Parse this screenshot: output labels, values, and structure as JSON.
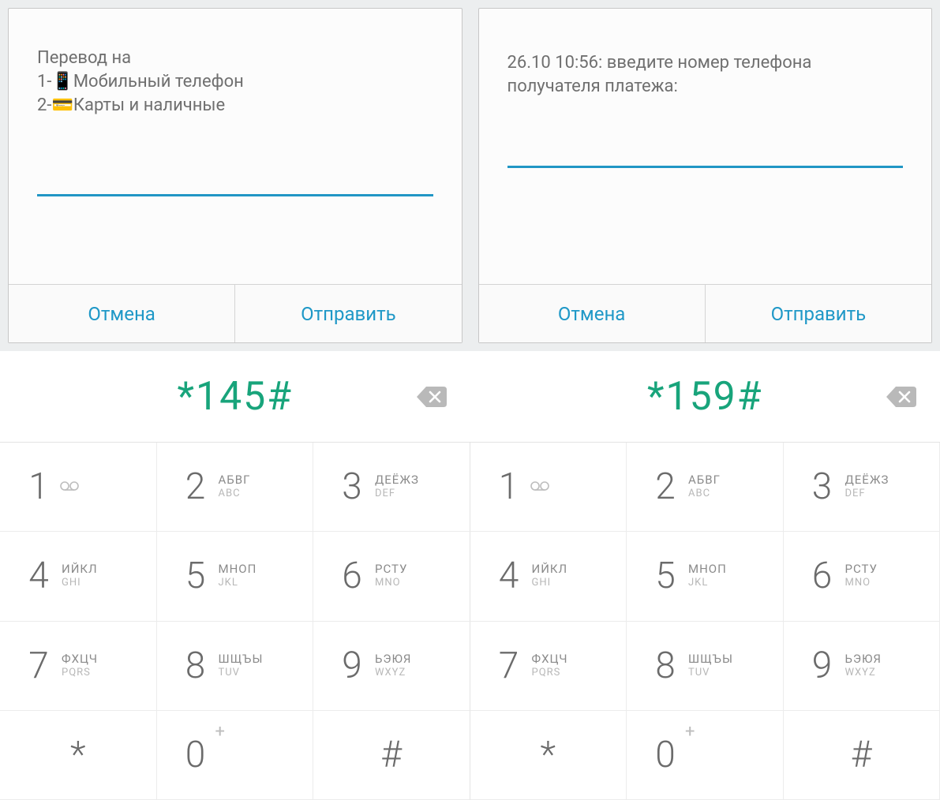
{
  "dialogs": {
    "left": {
      "line1": "Перевод на",
      "line2": "1-📱Мобильный телефон",
      "line3": "2-💳Карты и наличные",
      "cancel": "Отмена",
      "send": "Отправить"
    },
    "right": {
      "line1": "26.10 10:56: введите номер телефона",
      "line2": "получателя платежа:",
      "cancel": "Отмена",
      "send": "Отправить"
    }
  },
  "dial": {
    "left": "*145#",
    "right": "*159#"
  },
  "keypad": [
    {
      "d": "1",
      "l1": "",
      "l2": "",
      "vm": true
    },
    {
      "d": "2",
      "l1": "АБВГ",
      "l2": "ABC"
    },
    {
      "d": "3",
      "l1": "ДЕЁЖЗ",
      "l2": "DEF"
    },
    {
      "d": "4",
      "l1": "ИЙКЛ",
      "l2": "GHI"
    },
    {
      "d": "5",
      "l1": "МНОП",
      "l2": "JKL"
    },
    {
      "d": "6",
      "l1": "РСТУ",
      "l2": "MNO"
    },
    {
      "d": "7",
      "l1": "ФХЦЧ",
      "l2": "PQRS"
    },
    {
      "d": "8",
      "l1": "ШЩЪЫ",
      "l2": "TUV"
    },
    {
      "d": "9",
      "l1": "ЬЭЮЯ",
      "l2": "WXYZ"
    },
    {
      "d": "*",
      "sym": true
    },
    {
      "d": "0",
      "zero": true,
      "plus": "+"
    },
    {
      "d": "#",
      "sym": true
    }
  ],
  "colors": {
    "accent": "#1f98c7",
    "dialed": "#18a47b"
  }
}
